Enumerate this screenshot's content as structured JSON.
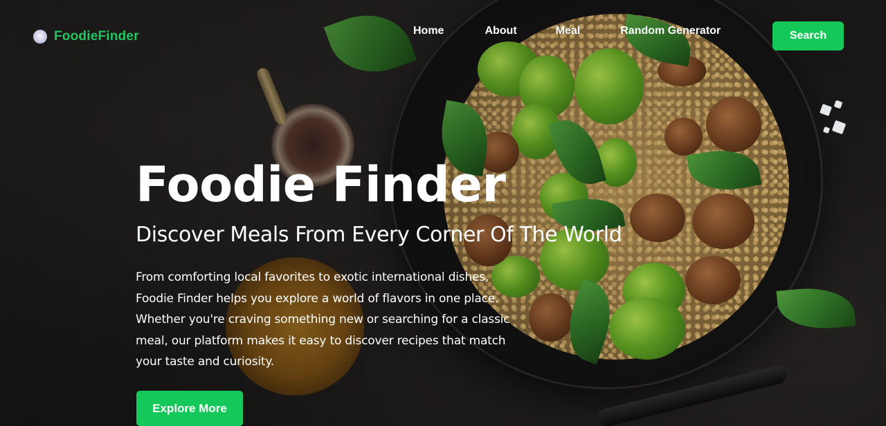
{
  "brand": {
    "name": "FoodieFinder",
    "accent_color": "#22c55e",
    "logo_icon": "plate-icon"
  },
  "nav": {
    "links": [
      "Home",
      "About",
      "Meal",
      "Random Generator"
    ],
    "search_label": "Search"
  },
  "hero": {
    "title": "Foodie Finder",
    "subtitle": "Discover Meals From Every Corner Of The World",
    "description_lines": [
      "From comforting local favorites to exotic international dishes,",
      "Foodie Finder helps you explore a world of flavors in one place.",
      "Whether you're craving something new or searching for a classic",
      "meal, our platform makes it easy to discover recipes that match",
      "your taste and curiosity."
    ],
    "cta_label": "Explore More",
    "background_image": "food-bowl-photo"
  }
}
